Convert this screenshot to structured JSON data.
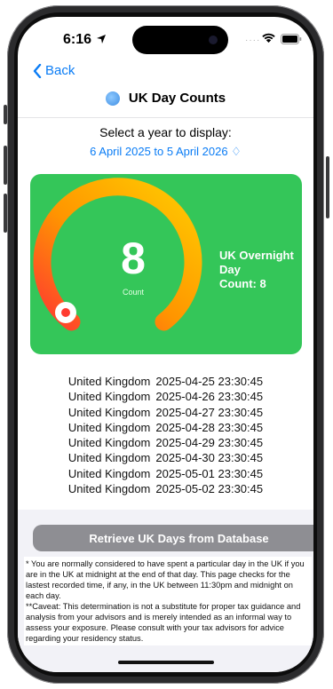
{
  "status_bar": {
    "time": "6:16"
  },
  "nav": {
    "back_label": "Back",
    "title": "UK Day Counts"
  },
  "year_selector": {
    "prompt": "Select a year to display:",
    "selected": "6 April 2025 to 5 April 2026 ♢"
  },
  "gauge": {
    "count": "8",
    "count_label": "Count",
    "side_label_line1": "UK Overnight Day",
    "side_label_line2": "Count: 8",
    "colors": {
      "start": "#ff3b30",
      "mid": "#ff9500",
      "end": "#ffcc00",
      "card": "#34c659"
    }
  },
  "days": [
    {
      "country": "United Kingdom",
      "timestamp": "2025-04-25 23:30:45"
    },
    {
      "country": "United Kingdom",
      "timestamp": "2025-04-26 23:30:45"
    },
    {
      "country": "United Kingdom",
      "timestamp": "2025-04-27 23:30:45"
    },
    {
      "country": "United Kingdom",
      "timestamp": "2025-04-28 23:30:45"
    },
    {
      "country": "United Kingdom",
      "timestamp": "2025-04-29 23:30:45"
    },
    {
      "country": "United Kingdom",
      "timestamp": "2025-04-30 23:30:45"
    },
    {
      "country": "United Kingdom",
      "timestamp": "2025-05-01 23:30:45"
    },
    {
      "country": "United Kingdom",
      "timestamp": "2025-05-02 23:30:45"
    }
  ],
  "retrieve_button": "Retrieve UK Days from Database",
  "note": {
    "paragraph1": "* You are normally considered to have spent a particular day in the UK if you are in the UK at midnight at the end of that day.  This page checks for the lastest recorded time, if any, in the UK between 11:30pm and midnight on each day.",
    "paragraph2": "**Caveat:  This determination is not a substitute for proper tax guidance and analysis from your advisors and is merely intended as an informal way to assess your exposure.  Please consult with your tax advisors for advice regarding your residency status."
  }
}
